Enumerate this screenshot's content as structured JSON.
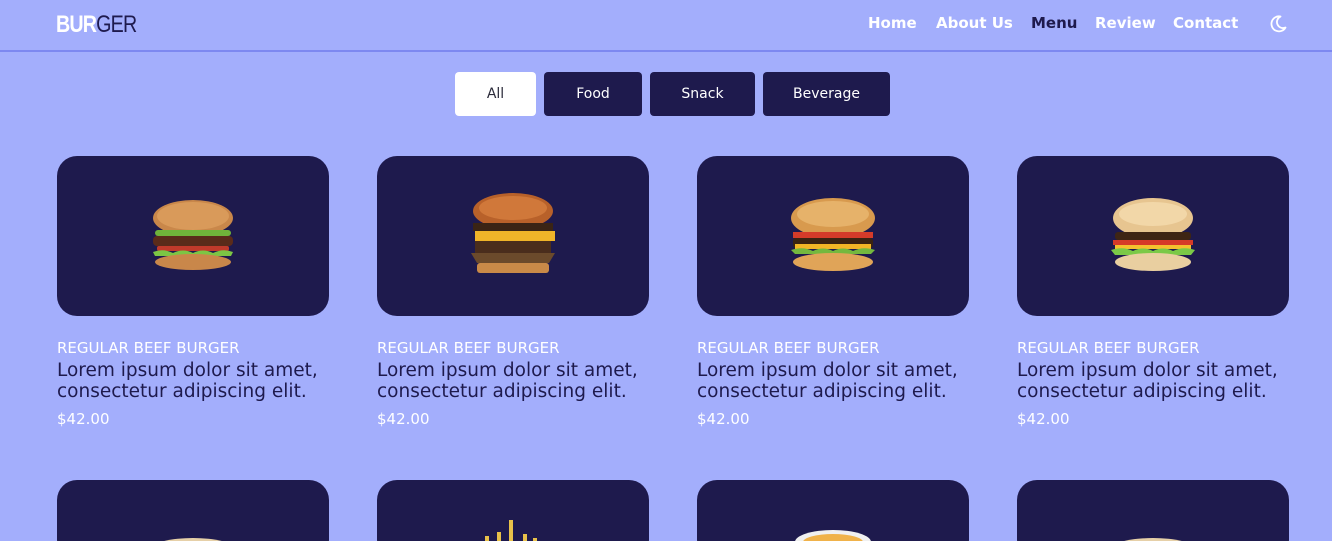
{
  "brand": {
    "part1": "BUR",
    "part2": "GER"
  },
  "nav": {
    "items": [
      {
        "label": "Home"
      },
      {
        "label": "About Us"
      },
      {
        "label": "Menu"
      },
      {
        "label": "Review"
      },
      {
        "label": "Contact"
      }
    ],
    "active": "Menu",
    "theme_icon": "moon-icon"
  },
  "filters": [
    {
      "label": "All",
      "active": true
    },
    {
      "label": "Food"
    },
    {
      "label": "Snack"
    },
    {
      "label": "Beverage"
    }
  ],
  "products": [
    {
      "category": "REGULAR BEEF BURGER",
      "description": "Lorem ipsum dolor sit amet, consectetur adipiscing elit.",
      "price": "$42.00",
      "image": "burger-photo"
    },
    {
      "category": "REGULAR BEEF BURGER",
      "description": "Lorem ipsum dolor sit amet, consectetur adipiscing elit.",
      "price": "$42.00",
      "image": "burger-photo"
    },
    {
      "category": "REGULAR BEEF BURGER",
      "description": "Lorem ipsum dolor sit amet, consectetur adipiscing elit.",
      "price": "$42.00",
      "image": "burger-photo"
    },
    {
      "category": "REGULAR BEEF BURGER",
      "description": "Lorem ipsum dolor sit amet, consectetur adipiscing elit.",
      "price": "$42.00",
      "image": "burger-photo"
    }
  ],
  "colors": {
    "background": "#a3aefc",
    "dark": "#1e1a4d",
    "white": "#ffffff"
  }
}
